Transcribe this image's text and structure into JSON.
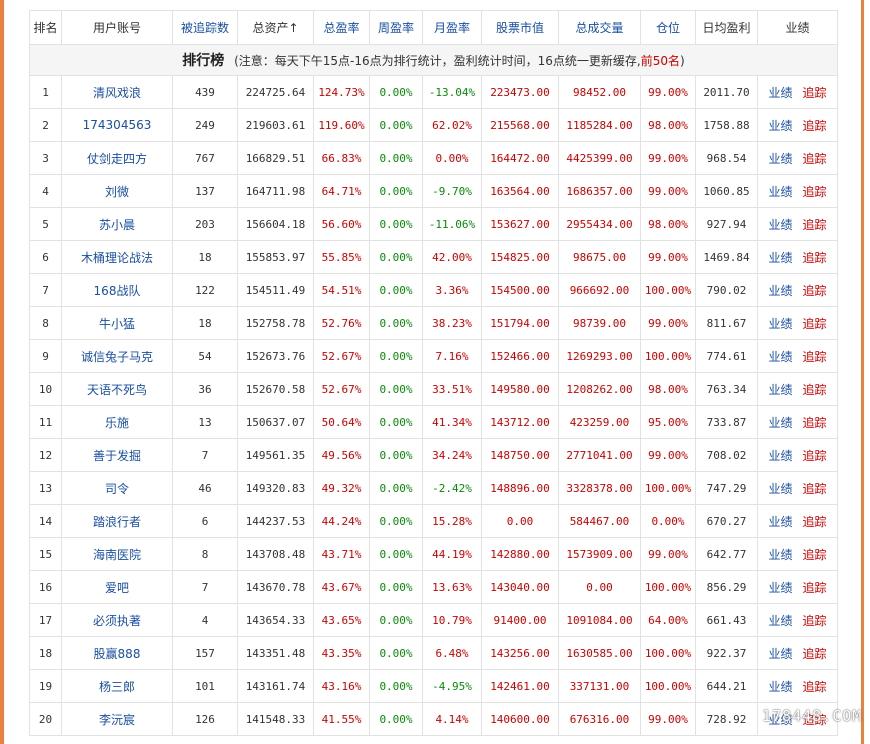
{
  "title": {
    "main": "排行榜",
    "note_prefix": "(注意：每天下午15点-16点为排行统计，盈利统计时间，16点统一更新缓存,",
    "note_red": "前50名",
    "note_suffix": ")"
  },
  "headers": [
    "排名",
    "用户账号",
    "被追踪数",
    "总资产↑",
    "总盈率",
    "周盈率",
    "月盈率",
    "股票市值",
    "总成交量",
    "仓位",
    "日均盈利",
    "业绩"
  ],
  "action_labels": {
    "performance": "业绩",
    "track": "追踪"
  },
  "colors": {
    "accent_red": "#cc0000",
    "link_blue": "#1a4fa3",
    "positive_green": "#0a8a0a",
    "frame_orange": "#e8823c"
  },
  "rows": [
    {
      "rank": "1",
      "name": "清风戏浪",
      "followers": "439",
      "assets": "224725.64",
      "total": "124.73%",
      "week": "0.00%",
      "month": "-13.04%",
      "stock": "223473.00",
      "volume": "98452.00",
      "position": "99.00%",
      "daily": "2011.70"
    },
    {
      "rank": "2",
      "name": "174304563",
      "followers": "249",
      "assets": "219603.61",
      "total": "119.60%",
      "week": "0.00%",
      "month": "62.02%",
      "stock": "215568.00",
      "volume": "1185284.00",
      "position": "98.00%",
      "daily": "1758.88"
    },
    {
      "rank": "3",
      "name": "仗剑走四方",
      "followers": "767",
      "assets": "166829.51",
      "total": "66.83%",
      "week": "0.00%",
      "month": "0.00%",
      "stock": "164472.00",
      "volume": "4425399.00",
      "position": "99.00%",
      "daily": "968.54"
    },
    {
      "rank": "4",
      "name": "刘微",
      "followers": "137",
      "assets": "164711.98",
      "total": "64.71%",
      "week": "0.00%",
      "month": "-9.70%",
      "stock": "163564.00",
      "volume": "1686357.00",
      "position": "99.00%",
      "daily": "1060.85"
    },
    {
      "rank": "5",
      "name": "苏小晨",
      "followers": "203",
      "assets": "156604.18",
      "total": "56.60%",
      "week": "0.00%",
      "month": "-11.06%",
      "stock": "153627.00",
      "volume": "2955434.00",
      "position": "98.00%",
      "daily": "927.94"
    },
    {
      "rank": "6",
      "name": "木桶理论战法",
      "followers": "18",
      "assets": "155853.97",
      "total": "55.85%",
      "week": "0.00%",
      "month": "42.00%",
      "stock": "154825.00",
      "volume": "98675.00",
      "position": "99.00%",
      "daily": "1469.84"
    },
    {
      "rank": "7",
      "name": "168战队",
      "followers": "122",
      "assets": "154511.49",
      "total": "54.51%",
      "week": "0.00%",
      "month": "3.36%",
      "stock": "154500.00",
      "volume": "966692.00",
      "position": "100.00%",
      "daily": "790.02"
    },
    {
      "rank": "8",
      "name": "牛小猛",
      "followers": "18",
      "assets": "152758.78",
      "total": "52.76%",
      "week": "0.00%",
      "month": "38.23%",
      "stock": "151794.00",
      "volume": "98739.00",
      "position": "99.00%",
      "daily": "811.67"
    },
    {
      "rank": "9",
      "name": "诚信兔子马克",
      "followers": "54",
      "assets": "152673.76",
      "total": "52.67%",
      "week": "0.00%",
      "month": "7.16%",
      "stock": "152466.00",
      "volume": "1269293.00",
      "position": "100.00%",
      "daily": "774.61"
    },
    {
      "rank": "10",
      "name": "天语不死鸟",
      "followers": "36",
      "assets": "152670.58",
      "total": "52.67%",
      "week": "0.00%",
      "month": "33.51%",
      "stock": "149580.00",
      "volume": "1208262.00",
      "position": "98.00%",
      "daily": "763.34"
    },
    {
      "rank": "11",
      "name": "乐施",
      "followers": "13",
      "assets": "150637.07",
      "total": "50.64%",
      "week": "0.00%",
      "month": "41.34%",
      "stock": "143712.00",
      "volume": "423259.00",
      "position": "95.00%",
      "daily": "733.87"
    },
    {
      "rank": "12",
      "name": "善于发掘",
      "followers": "7",
      "assets": "149561.35",
      "total": "49.56%",
      "week": "0.00%",
      "month": "34.24%",
      "stock": "148750.00",
      "volume": "2771041.00",
      "position": "99.00%",
      "daily": "708.02"
    },
    {
      "rank": "13",
      "name": "司令",
      "followers": "46",
      "assets": "149320.83",
      "total": "49.32%",
      "week": "0.00%",
      "month": "-2.42%",
      "stock": "148896.00",
      "volume": "3328378.00",
      "position": "100.00%",
      "daily": "747.29"
    },
    {
      "rank": "14",
      "name": "踏浪行者",
      "followers": "6",
      "assets": "144237.53",
      "total": "44.24%",
      "week": "0.00%",
      "month": "15.28%",
      "stock": "0.00",
      "volume": "584467.00",
      "position": "0.00%",
      "daily": "670.27"
    },
    {
      "rank": "15",
      "name": "海南医院",
      "followers": "8",
      "assets": "143708.48",
      "total": "43.71%",
      "week": "0.00%",
      "month": "44.19%",
      "stock": "142880.00",
      "volume": "1573909.00",
      "position": "99.00%",
      "daily": "642.77"
    },
    {
      "rank": "16",
      "name": "爱吧",
      "followers": "7",
      "assets": "143670.78",
      "total": "43.67%",
      "week": "0.00%",
      "month": "13.63%",
      "stock": "143040.00",
      "volume": "0.00",
      "position": "100.00%",
      "daily": "856.29"
    },
    {
      "rank": "17",
      "name": "必须执著",
      "followers": "4",
      "assets": "143654.33",
      "total": "43.65%",
      "week": "0.00%",
      "month": "10.79%",
      "stock": "91400.00",
      "volume": "1091084.00",
      "position": "64.00%",
      "daily": "661.43"
    },
    {
      "rank": "18",
      "name": "股赢888",
      "followers": "157",
      "assets": "143351.48",
      "total": "43.35%",
      "week": "0.00%",
      "month": "6.48%",
      "stock": "143256.00",
      "volume": "1630585.00",
      "position": "100.00%",
      "daily": "922.37"
    },
    {
      "rank": "19",
      "name": "杨三郎",
      "followers": "101",
      "assets": "143161.74",
      "total": "43.16%",
      "week": "0.00%",
      "month": "-4.95%",
      "stock": "142461.00",
      "volume": "337131.00",
      "position": "100.00%",
      "daily": "644.21"
    },
    {
      "rank": "20",
      "name": "李沅宸",
      "followers": "126",
      "assets": "141548.33",
      "total": "41.55%",
      "week": "0.00%",
      "month": "4.14%",
      "stock": "140600.00",
      "volume": "676316.00",
      "position": "99.00%",
      "daily": "728.92"
    }
  ],
  "watermark": "178448.COM"
}
